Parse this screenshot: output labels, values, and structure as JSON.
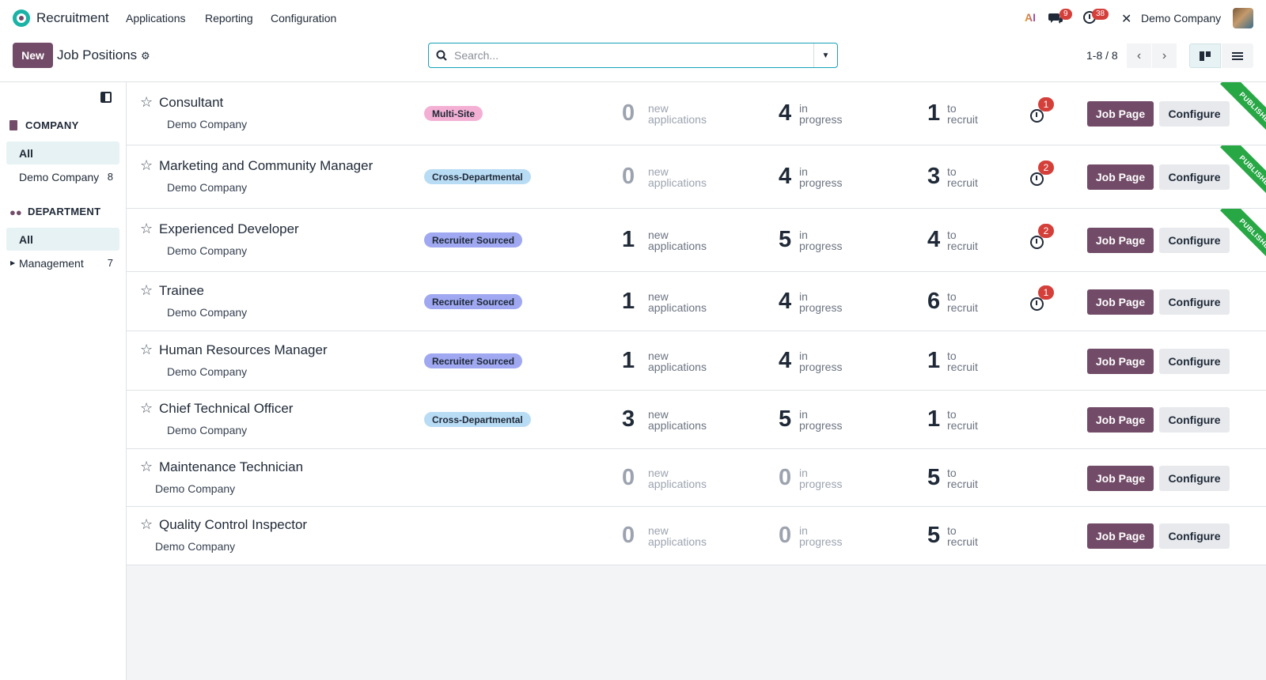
{
  "navbar": {
    "app_name": "Recruitment",
    "menu": [
      "Applications",
      "Reporting",
      "Configuration"
    ],
    "messages_count": "9",
    "activities_count": "38",
    "company": "Demo Company",
    "ai_label": "AI"
  },
  "control": {
    "new_label": "New",
    "title": "Job Positions",
    "search_placeholder": "Search...",
    "pager": "1-8 / 8"
  },
  "sidebar": {
    "company_header": "COMPANY",
    "company_items": [
      {
        "label": "All"
      },
      {
        "label": "Demo Company",
        "count": "8"
      }
    ],
    "department_header": "DEPARTMENT",
    "department_items": [
      {
        "label": "All"
      },
      {
        "label": "Management",
        "count": "7"
      }
    ]
  },
  "labels": {
    "new_top": "new",
    "new_bottom": "applications",
    "prog_top": "in",
    "prog_bottom": "progress",
    "recruit_top": "to",
    "recruit_bottom": "recruit",
    "job_page": "Job Page",
    "configure": "Configure",
    "published": "PUBLISHED"
  },
  "tag_colors": {
    "Multi-Site": "#f3b0d4",
    "Cross-Departmental": "#b9dcf5",
    "Recruiter Sourced": "#9fa8f0"
  },
  "jobs": [
    {
      "title": "Consultant",
      "company": "Demo Company",
      "tag": "Multi-Site",
      "new_apps": "0",
      "in_progress": "4",
      "to_recruit": "1",
      "activities": "1",
      "published": true
    },
    {
      "title": "Marketing and Community Manager",
      "company": "Demo Company",
      "tag": "Cross-Departmental",
      "new_apps": "0",
      "in_progress": "4",
      "to_recruit": "3",
      "activities": "2",
      "published": true
    },
    {
      "title": "Experienced Developer",
      "company": "Demo Company",
      "tag": "Recruiter Sourced",
      "new_apps": "1",
      "in_progress": "5",
      "to_recruit": "4",
      "activities": "2",
      "published": true
    },
    {
      "title": "Trainee",
      "company": "Demo Company",
      "tag": "Recruiter Sourced",
      "new_apps": "1",
      "in_progress": "4",
      "to_recruit": "6",
      "activities": "1",
      "published": false
    },
    {
      "title": "Human Resources Manager",
      "company": "Demo Company",
      "tag": "Recruiter Sourced",
      "new_apps": "1",
      "in_progress": "4",
      "to_recruit": "1",
      "activities": "",
      "published": false
    },
    {
      "title": "Chief Technical Officer",
      "company": "Demo Company",
      "tag": "Cross-Departmental",
      "new_apps": "3",
      "in_progress": "5",
      "to_recruit": "1",
      "activities": "",
      "published": false
    },
    {
      "title": "Maintenance Technician",
      "company": "Demo Company",
      "tag": "",
      "new_apps": "0",
      "in_progress": "0",
      "to_recruit": "5",
      "activities": "",
      "published": false
    },
    {
      "title": "Quality Control Inspector",
      "company": "Demo Company",
      "tag": "",
      "new_apps": "0",
      "in_progress": "0",
      "to_recruit": "5",
      "activities": "",
      "published": false
    }
  ]
}
